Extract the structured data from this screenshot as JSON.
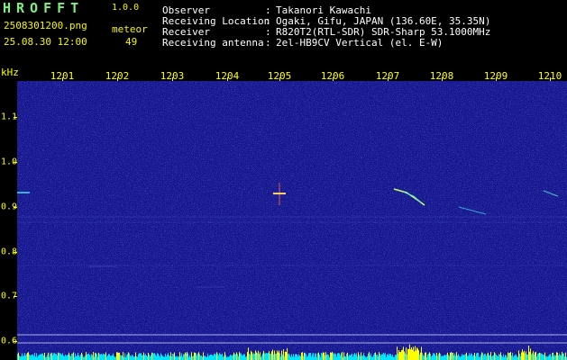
{
  "app": {
    "title": "HROFFT",
    "version": "1.0.0"
  },
  "file": {
    "name": "2508301200.png",
    "datetime": "25.08.30 12:00"
  },
  "meteor": {
    "label": "meteor",
    "count": "49"
  },
  "info": [
    {
      "label": "Observer",
      "value": "Takanori Kawachi"
    },
    {
      "label": "Receiving Location",
      "value": "Ogaki, Gifu, JAPAN (136.60E, 35.35N)"
    },
    {
      "label": "Receiver",
      "value": "R820T2(RTL-SDR) SDR-Sharp 53.1000MHz"
    },
    {
      "label": "Receiving antenna",
      "value": "2el-HB9CV Vertical (el. E-W)"
    }
  ],
  "axes": {
    "y_unit": "kHz",
    "x_ticks": [
      "1201",
      "1202",
      "1203",
      "1204",
      "1205",
      "1206",
      "1207",
      "1208",
      "1209",
      "1210"
    ],
    "y_ticks": [
      "1.1",
      "1.0",
      "0.9",
      "0.8",
      "0.7",
      "0.6"
    ]
  },
  "colors": {
    "background": "#14148c",
    "axis_text": "#ffff00",
    "title_green": "#7ef07e",
    "carrier": "#40e0d0",
    "histogram_cyan": "#00e5ff",
    "histogram_yellow": "#ffff00"
  }
}
